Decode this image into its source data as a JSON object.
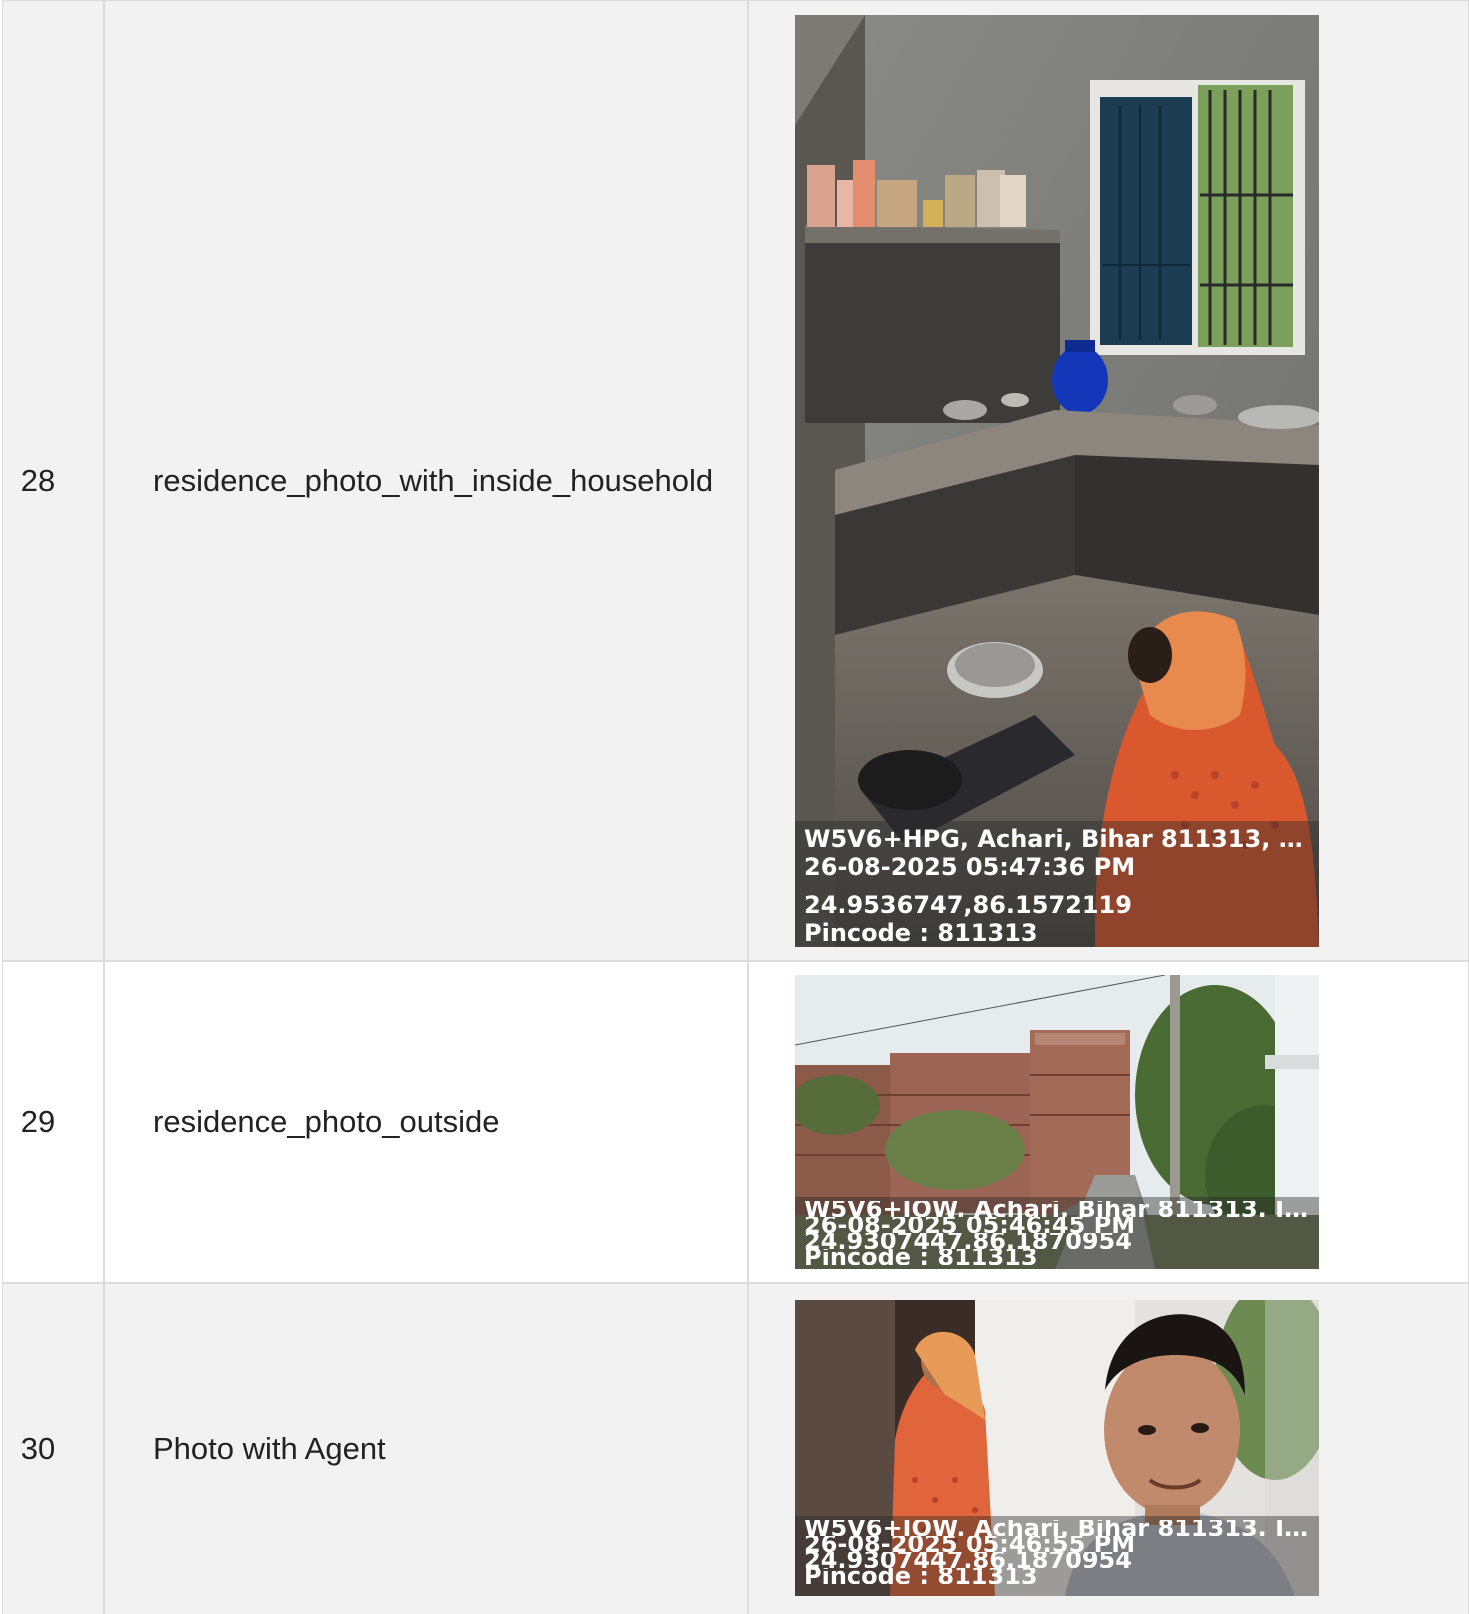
{
  "rows": [
    {
      "number": "28",
      "label": "residence_photo_with_inside_household",
      "photo": {
        "line1": "W5V6+HPG, Achari, Bihar 811313, India ...",
        "line2": "26-08-2025 05:47:36 PM",
        "line3": "24.9536747,86.1572119",
        "line4": "Pincode : 811313"
      }
    },
    {
      "number": "29",
      "label": "residence_photo_outside",
      "photo": {
        "line1": "W5V6+JOW, Achari, Bihar 811313, India ...",
        "line2": "26-08-2025 05:46:45 PM",
        "line3": "24.9307447,86.1870954",
        "line4": "Pincode : 811313"
      }
    },
    {
      "number": "30",
      "label": "Photo with Agent",
      "photo": {
        "line1": "W5V6+JOW, Achari, Bihar 811313, India ...",
        "line2": "26-08-2025 05:46:55 PM",
        "line3": "24.9307447,86.1870954",
        "line4": "Pincode : 811313"
      }
    }
  ]
}
